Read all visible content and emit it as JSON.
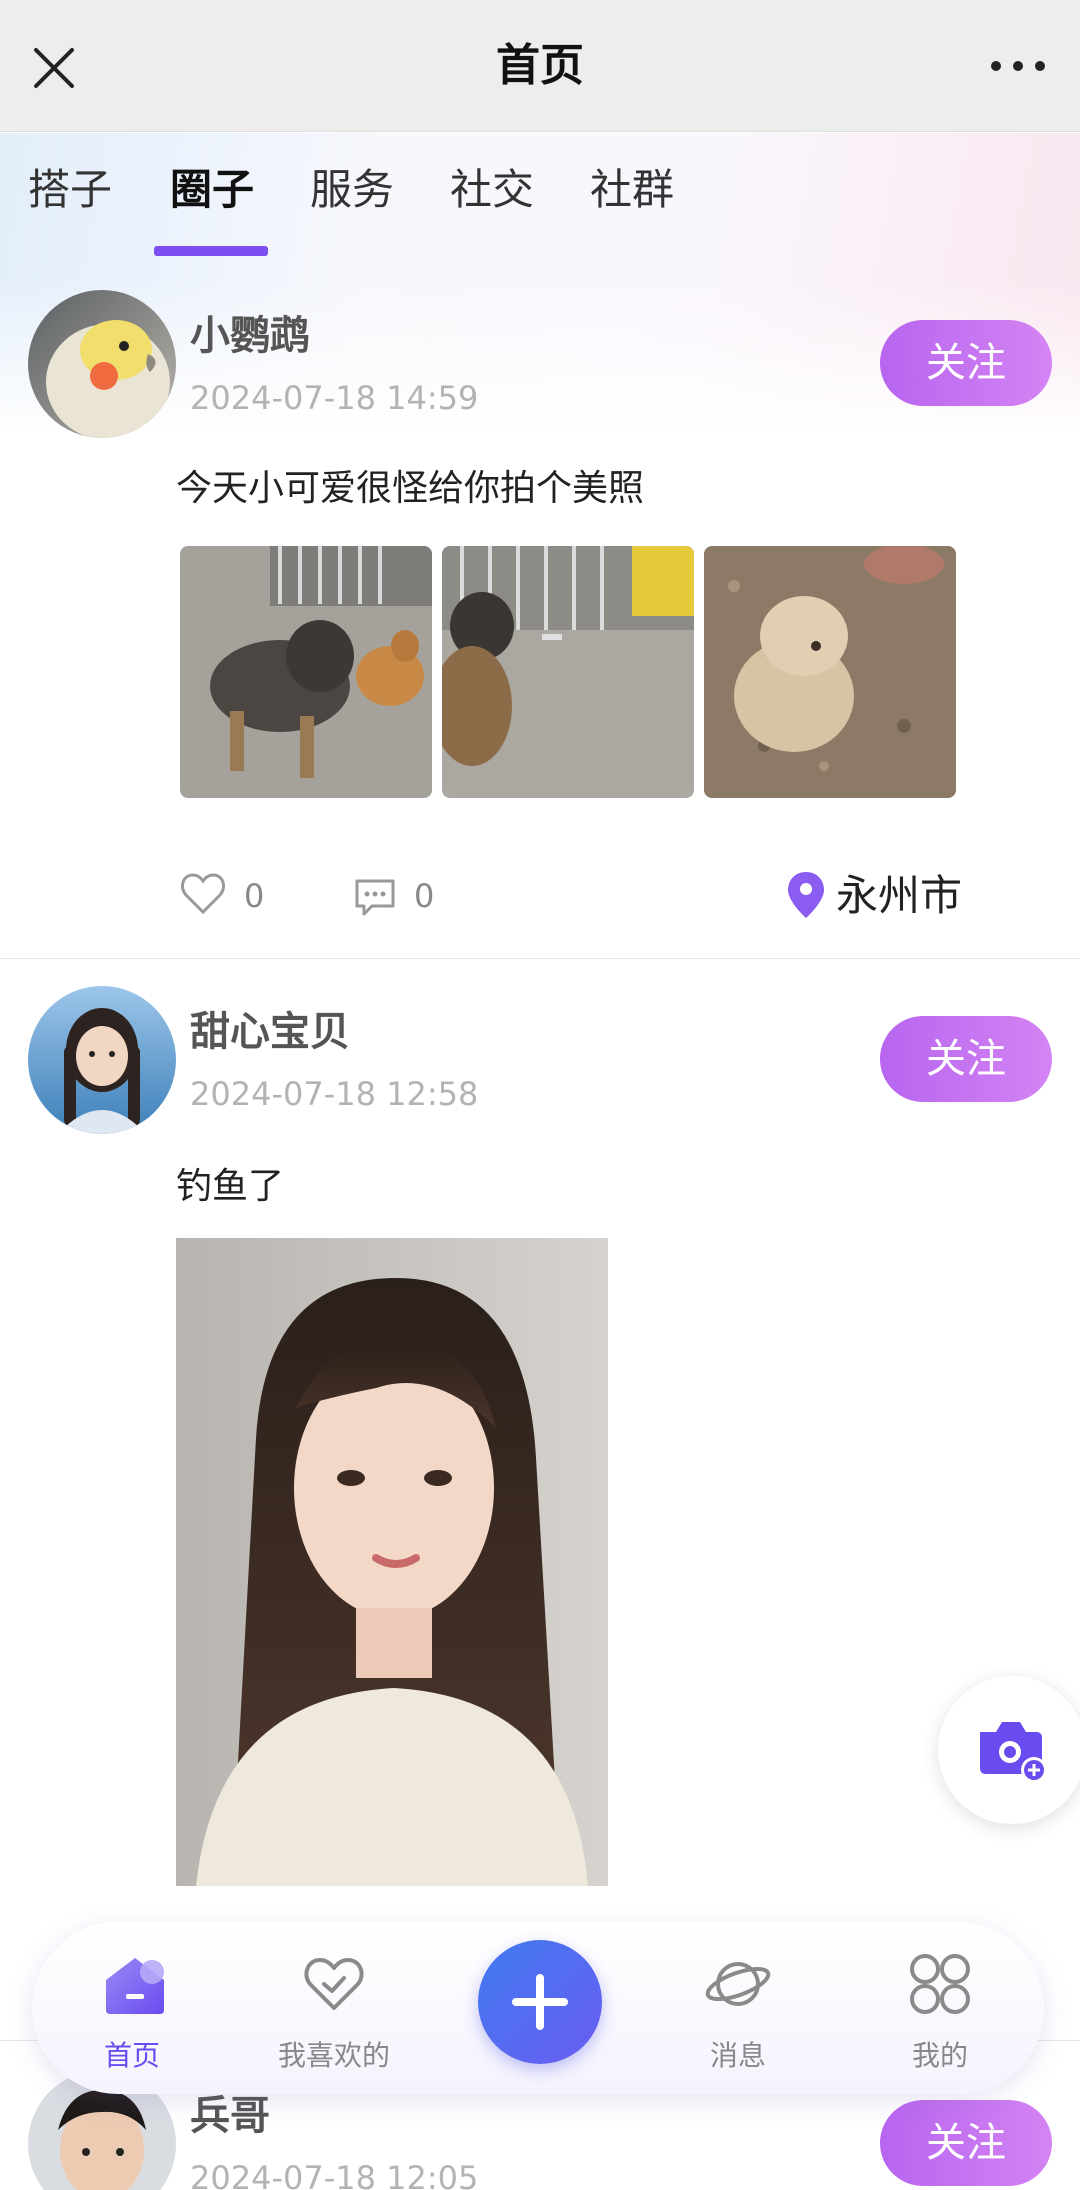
{
  "header": {
    "title": "首页",
    "close_icon": "close-icon",
    "more_icon": "more-dots-icon"
  },
  "tabs": [
    {
      "label": "搭子",
      "active": false
    },
    {
      "label": "圈子",
      "active": true
    },
    {
      "label": "服务",
      "active": false
    },
    {
      "label": "社交",
      "active": false
    },
    {
      "label": "社群",
      "active": false
    }
  ],
  "posts": [
    {
      "username": "小鹦鹉",
      "time": "2024-07-18 14:59",
      "follow_label": "关注",
      "text": "今天小可爱很怪给你拍个美照",
      "likes": "0",
      "comments": "0",
      "location": "永州市"
    },
    {
      "username": "甜心宝贝",
      "time": "2024-07-18 12:58",
      "follow_label": "关注",
      "text": "钓鱼了"
    },
    {
      "username": "兵哥",
      "time": "2024-07-18 12:05",
      "follow_label": "关注"
    }
  ],
  "tabbar": [
    {
      "label": "首页",
      "icon": "home-icon",
      "active": true
    },
    {
      "label": "我喜欢的",
      "icon": "heart-icon",
      "active": false
    },
    {
      "label": "",
      "icon": "plus-icon",
      "active": false
    },
    {
      "label": "消息",
      "icon": "planet-icon",
      "active": false
    },
    {
      "label": "我的",
      "icon": "grid-icon",
      "active": false
    }
  ],
  "colors": {
    "accent": "#7b4ff0",
    "follow_start": "#b765ef",
    "follow_end": "#d484f3",
    "plus_button": "#4f6ef0",
    "location_pin": "#8a5cf0"
  }
}
